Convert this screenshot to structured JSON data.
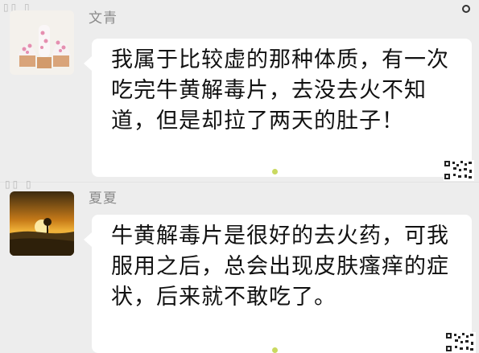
{
  "messages": [
    {
      "sender": "文青",
      "text": "我属于比较虚的那种体质，有一次吃完牛黄解毒片，去没去火不知道，但是却拉了两天的肚子！",
      "avatar_icon": "cupcake-icon"
    },
    {
      "sender": "夏夏",
      "text": "牛黄解毒片是很好的去火药，可我服用之后，总会出现皮肤瘙痒的症状，后来就不敢吃了。",
      "avatar_icon": "sunset-landscape-icon"
    }
  ],
  "colors": {
    "background": "#ededed",
    "bubble": "#ffffff",
    "nickname": "#8a8a8a",
    "dot": "#c9d960"
  }
}
